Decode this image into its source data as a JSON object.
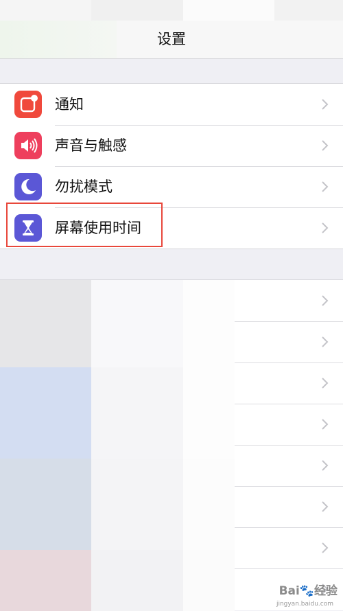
{
  "nav": {
    "title": "设置"
  },
  "settings": [
    {
      "label": "通知",
      "icon": "notification-icon",
      "color": "#f0493c"
    },
    {
      "label": "声音与触感",
      "icon": "sound-icon",
      "color": "#ee3f5d"
    },
    {
      "label": "勿扰模式",
      "icon": "moon-icon",
      "color": "#5b57d6"
    },
    {
      "label": "屏幕使用时间",
      "icon": "hourglass-icon",
      "color": "#5b57d6"
    }
  ],
  "highlight_color": "#e8473b",
  "watermark": {
    "text": "Bai🐾经验",
    "sub": "jingyan.baidu.com"
  }
}
